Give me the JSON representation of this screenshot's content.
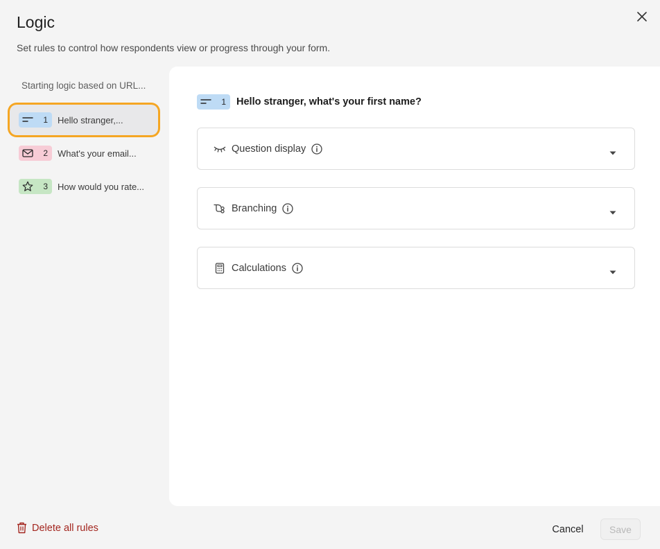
{
  "header": {
    "title": "Logic",
    "subtitle": "Set rules to control how respondents view or progress through your form."
  },
  "sidebar": {
    "start_label": "Starting logic based on URL...",
    "items": [
      {
        "number": "1",
        "label": "Hello stranger,...",
        "icon": "short-text-icon",
        "color": "#bedbf5",
        "selected": true
      },
      {
        "number": "2",
        "label": "What's your email...",
        "icon": "mail-icon",
        "color": "#f7ccd6",
        "selected": false
      },
      {
        "number": "3",
        "label": "How would you rate...",
        "icon": "star-icon",
        "color": "#c6e6c4",
        "selected": false
      }
    ]
  },
  "main": {
    "question": {
      "number": "1",
      "title": "Hello stranger, what's your first name?",
      "icon": "short-text-icon"
    },
    "panels": [
      {
        "label": "Question display",
        "icon": "eye-closed-icon"
      },
      {
        "label": "Branching",
        "icon": "branch-icon"
      },
      {
        "label": "Calculations",
        "icon": "calculator-icon"
      }
    ]
  },
  "footer": {
    "delete_label": "Delete all rules",
    "cancel_label": "Cancel",
    "save_label": "Save"
  },
  "colors": {
    "accent_outline": "#f5a623",
    "danger": "#a3261f"
  }
}
